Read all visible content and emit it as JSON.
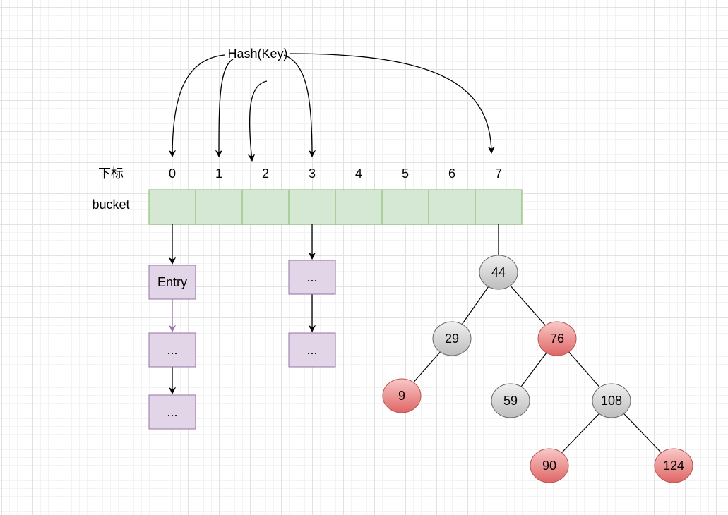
{
  "hash_label": "Hash(Key)",
  "index_label": "下标",
  "bucket_label": "bucket",
  "indices": [
    "0",
    "1",
    "2",
    "3",
    "4",
    "5",
    "6",
    "7"
  ],
  "chain_0": [
    "Entry",
    "...",
    "..."
  ],
  "chain_3": [
    "...",
    "..."
  ],
  "tree": {
    "nodes": [
      {
        "id": "44",
        "color": "gray"
      },
      {
        "id": "29",
        "color": "gray"
      },
      {
        "id": "76",
        "color": "red"
      },
      {
        "id": "9",
        "color": "red"
      },
      {
        "id": "59",
        "color": "gray"
      },
      {
        "id": "108",
        "color": "gray"
      },
      {
        "id": "90",
        "color": "red"
      },
      {
        "id": "124",
        "color": "red"
      }
    ],
    "edges": [
      [
        "44",
        "29"
      ],
      [
        "44",
        "76"
      ],
      [
        "29",
        "9"
      ],
      [
        "76",
        "59"
      ],
      [
        "76",
        "108"
      ],
      [
        "108",
        "90"
      ],
      [
        "108",
        "124"
      ]
    ]
  },
  "colors": {
    "bucket_fill": "#d5e8d4",
    "bucket_stroke": "#82b366",
    "entry_fill": "#e1d5e7",
    "entry_stroke": "#9673a6",
    "red_node": "#f19c99",
    "gray_node": "#d0d0d0"
  }
}
